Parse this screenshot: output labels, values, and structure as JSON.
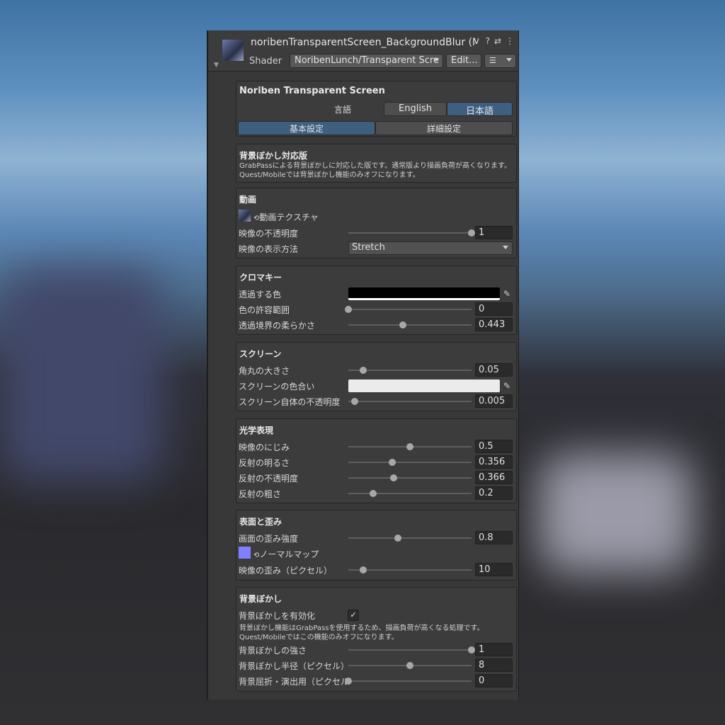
{
  "header": {
    "title": "noribenTransparentScreen_BackgroundBlur (Ma",
    "shader_label": "Shader",
    "shader_value": "NoribenLunch/Transparent Scre",
    "edit_label": "Edit...",
    "help_icon": "?",
    "preset_icon": "⇄",
    "more_icon": "⋮",
    "list_icon": "☰"
  },
  "lang": {
    "title": "Noriben Transparent Screen",
    "label": "言語",
    "english": "English",
    "japanese": "日本語",
    "tab_basic": "基本設定",
    "tab_detail": "詳細設定"
  },
  "notice": {
    "title": "背景ぼかし対応版",
    "desc": "GrabPassによる背景ぼかしに対応した版です。通常版より描画負荷が高くなります。Quest/Mobileでは背景ぼかし機能のみオフになります。"
  },
  "video": {
    "title": "動画",
    "texture_label": "動画テクスチャ",
    "opacity_label": "映像の不透明度",
    "opacity_value": "1",
    "opacity_frac": 1.0,
    "display_label": "映像の表示方法",
    "display_value": "Stretch"
  },
  "chroma": {
    "title": "クロマキー",
    "color_label": "透過する色",
    "color_value": "#000000",
    "tolerance_label": "色の許容範囲",
    "tolerance_value": "0",
    "tolerance_frac": 0.0,
    "softness_label": "透過境界の柔らかさ",
    "softness_value": "0.443",
    "softness_frac": 0.443
  },
  "screen": {
    "title": "スクリーン",
    "corner_label": "角丸の大きさ",
    "corner_value": "0.05",
    "corner_frac": 0.12,
    "tint_label": "スクリーンの色合い",
    "tint_value": "#ebebeb",
    "opacity_label": "スクリーン自体の不透明度",
    "opacity_value": "0.005",
    "opacity_frac": 0.05
  },
  "optics": {
    "title": "光学表現",
    "bleed_label": "映像のにじみ",
    "bleed_value": "0.5",
    "bleed_frac": 0.5,
    "refl_bright_label": "反射の明るさ",
    "refl_bright_value": "0.356",
    "refl_bright_frac": 0.356,
    "refl_opacity_label": "反射の不透明度",
    "refl_opacity_value": "0.366",
    "refl_opacity_frac": 0.366,
    "refl_rough_label": "反射の粗さ",
    "refl_rough_value": "0.2",
    "refl_rough_frac": 0.2
  },
  "surface": {
    "title": "表面と歪み",
    "distort_label": "画面の歪み強度",
    "distort_value": "0.8",
    "distort_frac": 0.4,
    "normal_label": "ノーマルマップ",
    "pixel_distort_label": "映像の歪み（ピクセル）",
    "pixel_distort_value": "10",
    "pixel_distort_frac": 0.12
  },
  "blur": {
    "title": "背景ぼかし",
    "enable_label": "背景ぼかしを有効化",
    "enable_checked": "✓",
    "desc": "背景ぼかし機能はGrabPassを使用するため、描画負荷が高くなる処理です。Quest/Mobileではこの機能のみオフになります。",
    "strength_label": "背景ぼかしの強さ",
    "strength_value": "1",
    "strength_frac": 1.0,
    "radius_label": "背景ぼかし半径（ピクセル）",
    "radius_value": "8",
    "radius_frac": 0.5,
    "refract_label": "背景屈折・演出用（ピクセル）",
    "refract_value": "0",
    "refract_frac": 0.0
  }
}
